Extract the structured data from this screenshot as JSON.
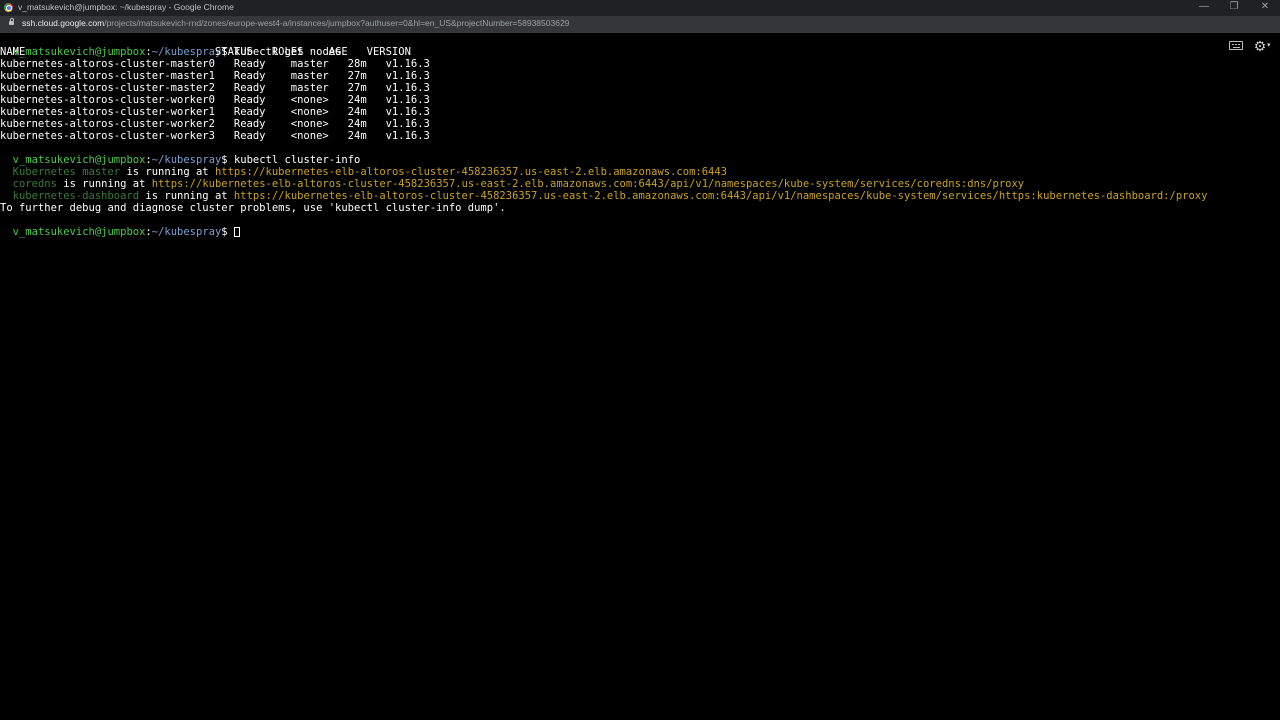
{
  "window": {
    "title": "v_matsukevich@jumpbox: ~/kubespray - Google Chrome",
    "minimize": "—",
    "restore": "❐",
    "close": "✕"
  },
  "address": {
    "host": "ssh.cloud.google.com",
    "path": "/projects/matsukevich-rnd/zones/europe-west4-a/instances/jumpbox?authuser=0&hl=en_US&projectNumber=58938503629"
  },
  "toolbar": {
    "keyboard_icon": "keyboard-icon",
    "gear_icon": "⚙",
    "caret": "▾"
  },
  "terminal": {
    "prompt_user": "v_matsukevich@jumpbox",
    "prompt_sep": ":",
    "prompt_path": "~/kubespray",
    "prompt_dollar": "$ ",
    "cmd1": "kubectl get nodes",
    "nodes_header": "NAME                              STATUS   ROLES    AGE   VERSION",
    "nodes": [
      "kubernetes-altoros-cluster-master0   Ready    master   28m   v1.16.3",
      "kubernetes-altoros-cluster-master1   Ready    master   27m   v1.16.3",
      "kubernetes-altoros-cluster-master2   Ready    master   27m   v1.16.3",
      "kubernetes-altoros-cluster-worker0   Ready    <none>   24m   v1.16.3",
      "kubernetes-altoros-cluster-worker1   Ready    <none>   24m   v1.16.3",
      "kubernetes-altoros-cluster-worker2   Ready    <none>   24m   v1.16.3",
      "kubernetes-altoros-cluster-worker3   Ready    <none>   24m   v1.16.3"
    ],
    "cmd2": "kubectl cluster-info",
    "info": [
      {
        "name": "Kubernetes master",
        "text": " is running at ",
        "url": "https://kubernetes-elb-altoros-cluster-458236357.us-east-2.elb.amazonaws.com:6443"
      },
      {
        "name": "coredns",
        "text": " is running at ",
        "url": "https://kubernetes-elb-altoros-cluster-458236357.us-east-2.elb.amazonaws.com:6443/api/v1/namespaces/kube-system/services/coredns:dns/proxy"
      },
      {
        "name": "kubernetes-dashboard",
        "text": " is running at ",
        "url": "https://kubernetes-elb-altoros-cluster-458236357.us-east-2.elb.amazonaws.com:6443/api/v1/namespaces/kube-system/services/https:kubernetes-dashboard:/proxy"
      }
    ],
    "debug_hint": "To further debug and diagnose cluster problems, use 'kubectl cluster-info dump'."
  }
}
